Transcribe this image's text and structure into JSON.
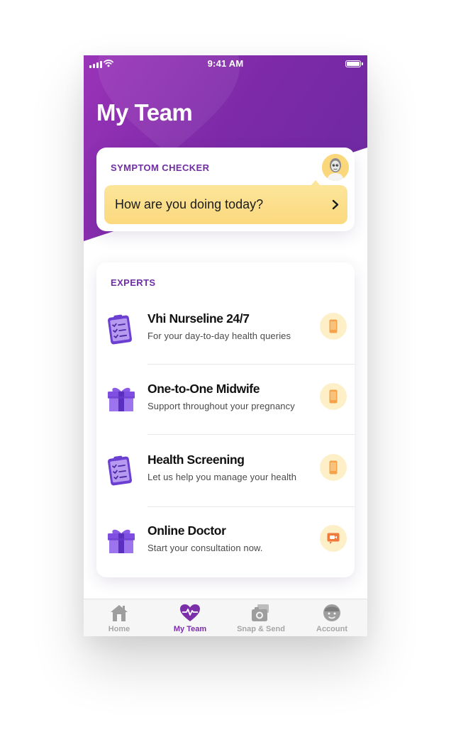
{
  "status_bar": {
    "time": "9:41 AM"
  },
  "header": {
    "title": "My Team"
  },
  "symptom_checker": {
    "label": "SYMPTOM CHECKER",
    "prompt": "How are you doing today?"
  },
  "experts": {
    "label": "EXPERTS",
    "items": [
      {
        "title": "Vhi Nurseline 24/7",
        "subtitle": "For your day-to-day health queries",
        "icon": "clipboard-icon",
        "action_icon": "phone-icon"
      },
      {
        "title": "One-to-One Midwife",
        "subtitle": "Support throughout your pregnancy",
        "icon": "gift-icon",
        "action_icon": "phone-icon"
      },
      {
        "title": "Health Screening",
        "subtitle": "Let us help you manage your health",
        "icon": "clipboard-icon",
        "action_icon": "phone-icon"
      },
      {
        "title": "Online Doctor",
        "subtitle": "Start your consultation now.",
        "icon": "gift-icon",
        "action_icon": "video-call-icon"
      }
    ]
  },
  "tab_bar": {
    "items": [
      {
        "label": "Home",
        "icon": "home-icon",
        "active": false
      },
      {
        "label": "My Team",
        "icon": "heart-pulse-icon",
        "active": true
      },
      {
        "label": "Snap & Send",
        "icon": "camera-icon",
        "active": false
      },
      {
        "label": "Account",
        "icon": "account-icon",
        "active": false
      }
    ]
  },
  "colors": {
    "brand_purple": "#7d2aa8",
    "section_label": "#6f2ea3",
    "bubble_yellow": "#fce59a",
    "action_orange": "#f5a24a",
    "video_red": "#f07a3c",
    "tab_inactive": "#a6a6a6"
  }
}
